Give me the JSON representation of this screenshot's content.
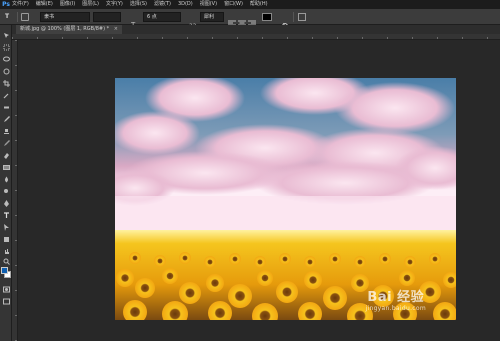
{
  "app": {
    "logo": "Ps"
  },
  "menu": [
    "文件(F)",
    "编辑(E)",
    "图像(I)",
    "图层(L)",
    "文字(Y)",
    "选择(S)",
    "滤镜(T)",
    "3D(D)",
    "视图(V)",
    "窗口(W)",
    "帮助(H)"
  ],
  "options": {
    "tool_glyph": "T",
    "font_family": "隶书",
    "font_size": "6 点",
    "anti_alias": "犀利",
    "color": "#000000"
  },
  "document": {
    "tab_label": "新城.jpg @ 100% (图层 1, RGB/8#) *",
    "close_glyph": "×"
  },
  "tools": [
    "move-icon",
    "marquee-icon",
    "lasso-icon",
    "quick-select-icon",
    "crop-icon",
    "eyedropper-icon",
    "healing-icon",
    "brush-icon",
    "stamp-icon",
    "history-brush-icon",
    "eraser-icon",
    "gradient-icon",
    "blur-icon",
    "dodge-icon",
    "pen-icon",
    "type-icon",
    "path-select-icon",
    "shape-icon",
    "hand-icon",
    "zoom-icon"
  ],
  "colors": {
    "foreground": "#0f5fb0",
    "background": "#ffffff"
  },
  "watermark": {
    "logo": "Bai 经验",
    "url": "jingyan.baidu.com"
  }
}
